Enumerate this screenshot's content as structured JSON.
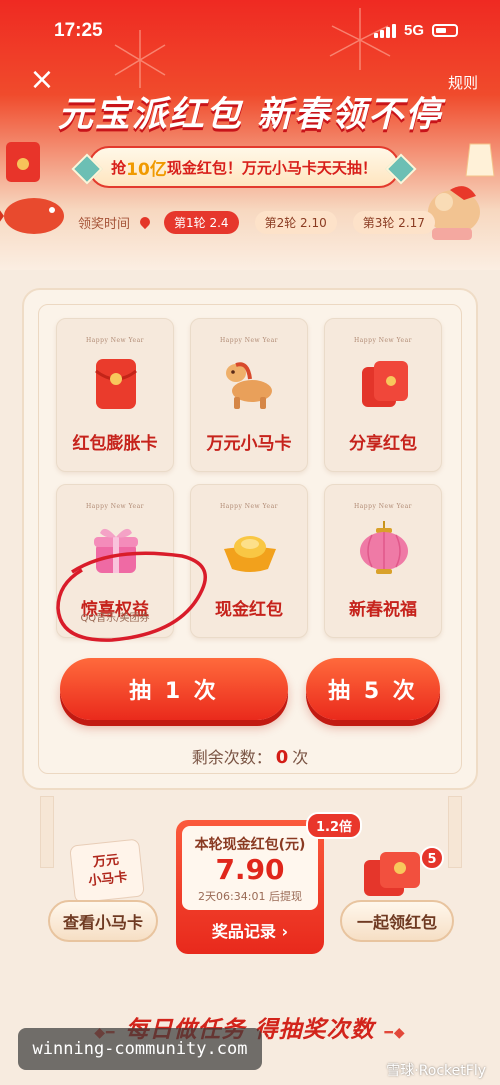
{
  "status_bar": {
    "time": "17:25",
    "network": "5G"
  },
  "header": {
    "rules": "规则",
    "title": "元宝派红包 新春领不停",
    "banner_prefix": "抢",
    "banner_highlight": "10亿",
    "banner_suffix": "现金红包！万元小马卡天天抽！",
    "timeline_label": "领奖时间",
    "rounds": [
      {
        "label": "第1轮 2.4",
        "active": true
      },
      {
        "label": "第2轮 2.10",
        "active": false
      },
      {
        "label": "第3轮 2.17",
        "active": false
      }
    ]
  },
  "prizes": {
    "hny": "Happy New Year",
    "items": [
      {
        "name": "红包膨胀卡",
        "icon": "red-envelope-icon"
      },
      {
        "name": "万元小马卡",
        "icon": "pony-icon"
      },
      {
        "name": "分享红包",
        "icon": "share-red-envelope-icon"
      },
      {
        "name": "惊喜权益",
        "sub": "QQ音乐/美团券",
        "icon": "gift-box-icon"
      },
      {
        "name": "现金红包",
        "icon": "gold-ingot-icon"
      },
      {
        "name": "新春祝福",
        "icon": "lantern-icon"
      }
    ]
  },
  "actions": {
    "draw_once": "抽 1 次",
    "draw_five": "抽 5 次",
    "remaining_label": "剩余次数：",
    "remaining_count": "0",
    "remaining_unit": "次"
  },
  "lower": {
    "horse_card_line1": "万元",
    "horse_card_line2": "小马卡",
    "view_horse": "查看小马卡",
    "cash_title": "本轮现金红包(元)",
    "cash_amount": "7.90",
    "cash_countdown": "2天06:34:01 后提现",
    "multiplier": "1.2倍",
    "record": "奖品记录 ›",
    "together": "一起领红包",
    "together_badge": "5"
  },
  "tasks": {
    "title": "每日做任务 得抽奖次数"
  },
  "watermark": {
    "left": "winning-community.com",
    "right": "雪球·RocketFly"
  },
  "colors": {
    "brand_red": "#e6372c",
    "gold": "#f09a00",
    "cream": "#fbf3e9"
  }
}
